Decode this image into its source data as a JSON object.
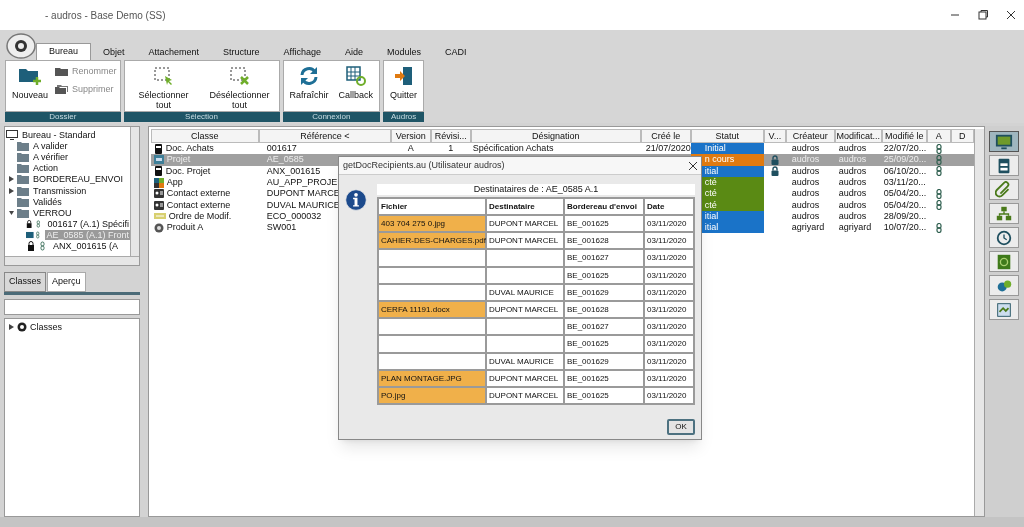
{
  "window": {
    "title": "- audros - Base Demo (SS)"
  },
  "tabs": [
    {
      "label": "Bureau",
      "selected": true
    },
    {
      "label": "Objet",
      "selected": false
    },
    {
      "label": "Attachement",
      "selected": false
    },
    {
      "label": "Structure",
      "selected": false
    },
    {
      "label": "Affichage",
      "selected": false
    },
    {
      "label": "Aide",
      "selected": false
    },
    {
      "label": "Modules",
      "selected": false
    },
    {
      "label": "CADI",
      "selected": false
    }
  ],
  "ribbon": [
    {
      "label": "Dossier",
      "buttons": [
        {
          "label": "Nouveau",
          "kind": "large",
          "disabled": false
        },
        {
          "label": "Renommer",
          "kind": "small",
          "disabled": true
        },
        {
          "label": "Supprimer",
          "kind": "small",
          "disabled": true
        }
      ]
    },
    {
      "label": "Sélection",
      "buttons": [
        {
          "label": "Sélectionner tout",
          "kind": "large",
          "disabled": false
        },
        {
          "label": "Désélectionner tout",
          "kind": "large",
          "disabled": false
        }
      ]
    },
    {
      "label": "Connexion",
      "buttons": [
        {
          "label": "Rafraîchir",
          "kind": "large",
          "disabled": false
        },
        {
          "label": "Callback",
          "kind": "large",
          "disabled": false
        }
      ]
    },
    {
      "label": "Audros",
      "buttons": [
        {
          "label": "Quitter",
          "kind": "large",
          "disabled": false
        }
      ]
    }
  ],
  "tree": [
    {
      "label": "Bureau - Standard",
      "kind": "desktop",
      "selected": false,
      "children": [
        {
          "label": "A valider",
          "kind": "folder",
          "selected": false
        },
        {
          "label": "A vérifier",
          "kind": "folder",
          "selected": false
        },
        {
          "label": "Action",
          "kind": "folder",
          "selected": false
        },
        {
          "label": "BORDEREAU_ENVOI",
          "kind": "folder",
          "selected": false,
          "expanded": false
        },
        {
          "label": "Transmission",
          "kind": "folder",
          "selected": false,
          "expanded": false
        },
        {
          "label": "Validés",
          "kind": "folder",
          "selected": false
        },
        {
          "label": "VERROU",
          "kind": "folder",
          "selected": false,
          "expanded": true,
          "children": [
            {
              "label": "001617 (A.1) Spécifi",
              "kind": "document",
              "selected": false
            },
            {
              "label": "AE_0585 (A.1) Front",
              "kind": "project",
              "selected": true
            },
            {
              "label": "ANX_001615 (A",
              "kind": "document",
              "selected": false
            }
          ]
        }
      ]
    }
  ],
  "panel_tabs": [
    {
      "label": "Classes",
      "selected": true
    },
    {
      "label": "Aperçu",
      "selected": false
    }
  ],
  "class_tree": [
    {
      "label": "Classes",
      "expanded": false
    }
  ],
  "table": {
    "columns": [
      "Classe",
      "Référence <",
      "Version",
      "Révisi...",
      "Désignation",
      "Créé le",
      "Statut",
      "V...",
      "Créateur",
      "Modificat...",
      "Modifié le",
      "A",
      "D"
    ],
    "rows": [
      {
        "kind": "document",
        "selected": false,
        "classe": "Doc. Achats",
        "reference": "001617",
        "version": "A",
        "revision": "1",
        "designation": "Spécification Achats",
        "created": "21/07/2020",
        "status": "Initial",
        "color": "#1a73c8",
        "locked": false,
        "creator": "audros",
        "modifier": "audros",
        "modified": "22/07/20...",
        "attached": true
      },
      {
        "kind": "project",
        "selected": true,
        "classe": "Projet",
        "reference": "AE_0585",
        "status": "n cours",
        "color": "#e07a10",
        "locked": true,
        "creator": "audros",
        "modifier": "audros",
        "modified": "25/09/20...",
        "attached": true
      },
      {
        "kind": "document",
        "selected": false,
        "classe": "Doc. Projet",
        "reference": "ANX_001615",
        "status": "itial",
        "color": "#1a73c8",
        "locked": true,
        "creator": "audros",
        "modifier": "audros",
        "modified": "06/10/20...",
        "attached": true
      },
      {
        "kind": "app",
        "selected": false,
        "classe": "App",
        "reference": "AU_APP_PROJE",
        "status": "cté",
        "color": "#5a8a14",
        "locked": false,
        "creator": "audros",
        "modifier": "audros",
        "modified": "03/11/20...",
        "attached": false
      },
      {
        "kind": "contact",
        "selected": false,
        "classe": "Contact externe",
        "reference": "DUPONT MARCE",
        "status": "cté",
        "color": "#5a8a14",
        "locked": false,
        "creator": "audros",
        "modifier": "audros",
        "modified": "05/04/20...",
        "attached": true
      },
      {
        "kind": "contact",
        "selected": false,
        "classe": "Contact externe",
        "reference": "DUVAL MAURICE",
        "status": "cté",
        "color": "#5a8a14",
        "locked": false,
        "creator": "audros",
        "modifier": "audros",
        "modified": "05/04/20...",
        "attached": true
      },
      {
        "kind": "change",
        "selected": false,
        "classe": "Ordre de Modif.",
        "reference": "ECO_000032",
        "status": "itial",
        "color": "#1a73c8",
        "locked": false,
        "creator": "audros",
        "modifier": "audros",
        "modified": "28/09/20...",
        "attached": false
      },
      {
        "kind": "product",
        "selected": false,
        "classe": "Produit A",
        "reference": "SW001",
        "status": "itial",
        "color": "#1a73c8",
        "locked": false,
        "creator": "agriyard",
        "modifier": "agriyard",
        "modified": "10/07/20...",
        "attached": true
      }
    ]
  },
  "sidebar": [
    {
      "selected": true
    },
    {
      "selected": false
    },
    {
      "selected": false
    },
    {
      "selected": false
    },
    {
      "selected": false
    },
    {
      "selected": false
    },
    {
      "selected": false
    },
    {
      "selected": false
    }
  ],
  "dialog": {
    "title": "getDocRecipients.au (Utilisateur audros)",
    "caption": "Destinataires de : AE_0585 A.1",
    "columns": [
      "Fichier",
      "Destinataire",
      "Bordereau d'envoi",
      "Date"
    ],
    "rows": [
      {
        "file": "403 704 275 0.jpg",
        "recipient": "DUPONT MARCEL",
        "slip": "BE_001625",
        "date": "03/11/2020"
      },
      {
        "file": "CAHIER-DES-CHARGES.pdf",
        "recipient": "DUPONT MARCEL",
        "slip": "BE_001628",
        "date": "03/11/2020"
      },
      {
        "slip": "BE_001627",
        "date": "03/11/2020"
      },
      {
        "slip": "BE_001625",
        "date": "03/11/2020"
      },
      {
        "recipient": "DUVAL MAURICE",
        "slip": "BE_001629",
        "date": "03/11/2020"
      },
      {
        "file": "CERFA 11191.docx",
        "recipient": "DUPONT MARCEL",
        "slip": "BE_001628",
        "date": "03/11/2020"
      },
      {
        "slip": "BE_001627",
        "date": "03/11/2020"
      },
      {
        "slip": "BE_001625",
        "date": "03/11/2020"
      },
      {
        "recipient": "DUVAL MAURICE",
        "slip": "BE_001629",
        "date": "03/11/2020"
      },
      {
        "file": "PLAN MONTAGE.JPG",
        "recipient": "DUPONT MARCEL",
        "slip": "BE_001625",
        "date": "03/11/2020"
      },
      {
        "file": "PO.jpg",
        "recipient": "DUPONT MARCEL",
        "slip": "BE_001625",
        "date": "03/11/2020"
      }
    ],
    "ok": "OK"
  }
}
